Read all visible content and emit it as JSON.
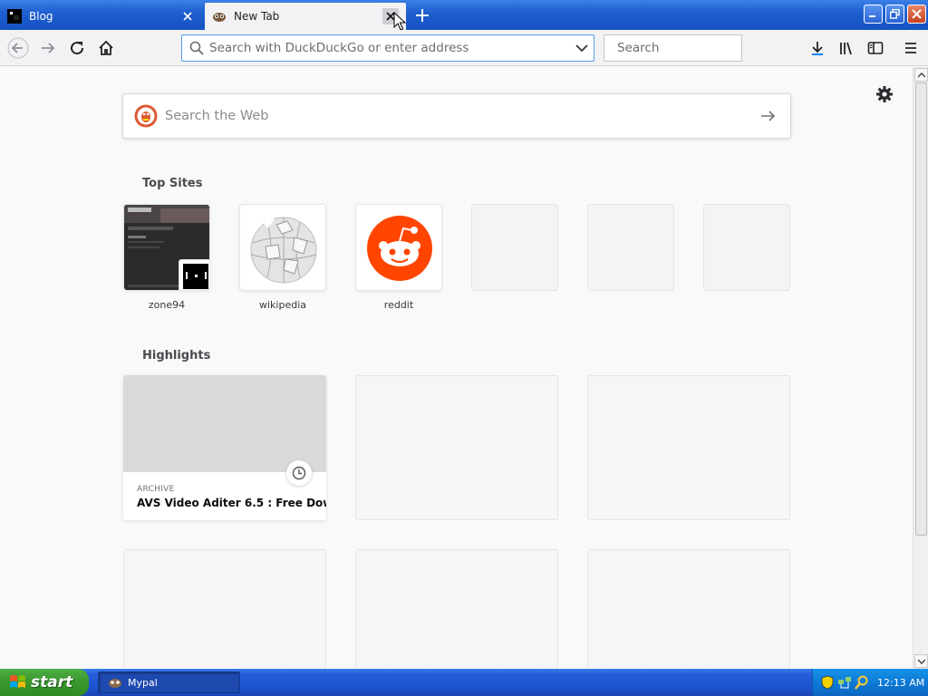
{
  "browser": {
    "tabs": [
      {
        "title": "Blog",
        "active": false
      },
      {
        "title": "New Tab",
        "active": true
      }
    ],
    "urlbar": {
      "placeholder": "Search with DuckDuckGo or enter address",
      "value": ""
    },
    "searchbar": {
      "placeholder": "Search",
      "value": ""
    }
  },
  "newtab": {
    "web_search": {
      "placeholder": "Search the Web"
    },
    "top_sites_title": "Top Sites",
    "top_sites": [
      {
        "label": "zone94",
        "icon": "zone94-screenshot"
      },
      {
        "label": "wikipedia",
        "icon": "wikipedia-globe-icon"
      },
      {
        "label": "reddit",
        "icon": "reddit-alien-icon"
      },
      {
        "label": "",
        "icon": ""
      },
      {
        "label": "",
        "icon": ""
      },
      {
        "label": "",
        "icon": ""
      }
    ],
    "highlights_title": "Highlights",
    "highlights": [
      {
        "context": "ARCHIVE",
        "title": "AVS Video Aditer 6.5 : Free Dow..."
      }
    ]
  },
  "taskbar": {
    "start_label": "start",
    "tasks": [
      {
        "label": "Mypal"
      }
    ],
    "clock": "12:13 AM"
  },
  "colors": {
    "accent": "#0a84ff",
    "reddit": "#ff4500",
    "titlebar": "#1f5fd0"
  }
}
